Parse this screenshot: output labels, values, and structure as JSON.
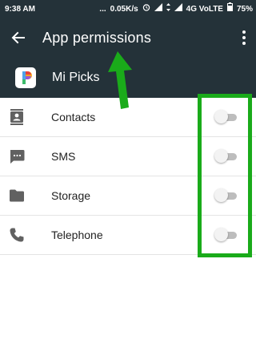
{
  "status_bar": {
    "time": "9:38 AM",
    "dots": "...",
    "speed": "0.05K/s",
    "network": "4G VoLTE",
    "battery": "75%"
  },
  "app_bar": {
    "title": "App permissions",
    "back_icon": "arrow-back-icon",
    "overflow_icon": "more-vert-icon"
  },
  "app": {
    "name": "Mi Picks",
    "logo_icon": "mi-picks-logo"
  },
  "permissions": [
    {
      "label": "Contacts",
      "icon": "contacts-icon",
      "enabled": false
    },
    {
      "label": "SMS",
      "icon": "sms-icon",
      "enabled": false
    },
    {
      "label": "Storage",
      "icon": "folder-icon",
      "enabled": false
    },
    {
      "label": "Telephone",
      "icon": "phone-icon",
      "enabled": false
    }
  ],
  "colors": {
    "header_bg": "#243239",
    "annotation_green": "#1aab1a",
    "toggle_off_track": "#bdbdbd",
    "toggle_off_thumb": "#f3f3f3"
  }
}
